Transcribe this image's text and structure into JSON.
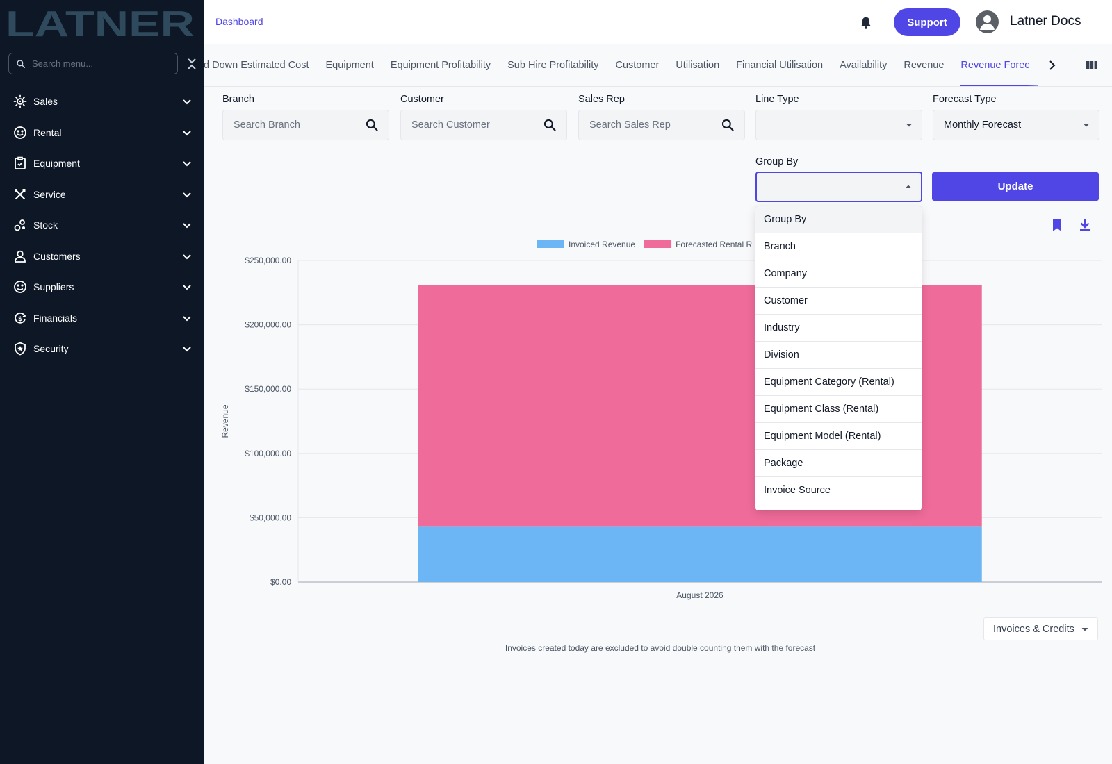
{
  "sidebar": {
    "logo_text": "LATNER",
    "search_placeholder": "Search menu...",
    "items": [
      {
        "label": "Sales",
        "icon": "sales-icon"
      },
      {
        "label": "Rental",
        "icon": "rental-icon"
      },
      {
        "label": "Equipment",
        "icon": "equipment-icon"
      },
      {
        "label": "Service",
        "icon": "service-icon"
      },
      {
        "label": "Stock",
        "icon": "stock-icon"
      },
      {
        "label": "Customers",
        "icon": "customers-icon"
      },
      {
        "label": "Suppliers",
        "icon": "suppliers-icon"
      },
      {
        "label": "Financials",
        "icon": "financials-icon"
      },
      {
        "label": "Security",
        "icon": "security-icon"
      }
    ]
  },
  "header": {
    "breadcrumb": "Dashboard",
    "support_label": "Support",
    "user_name": "Latner Docs"
  },
  "tabs": [
    {
      "label": "Breakdown Estimated Cost",
      "visible_label": "d Down Estimated Cost"
    },
    {
      "label": "Equipment"
    },
    {
      "label": "Equipment Profitability"
    },
    {
      "label": "Sub Hire Profitability"
    },
    {
      "label": "Customer"
    },
    {
      "label": "Utilisation"
    },
    {
      "label": "Financial Utilisation"
    },
    {
      "label": "Availability"
    },
    {
      "label": "Revenue"
    },
    {
      "label": "Revenue Forecast",
      "visible_label": "Revenue Forec"
    }
  ],
  "filters": {
    "branch": {
      "label": "Branch",
      "placeholder": "Search Branch"
    },
    "customer": {
      "label": "Customer",
      "placeholder": "Search Customer"
    },
    "sales_rep": {
      "label": "Sales Rep",
      "placeholder": "Search Sales Rep"
    },
    "line_type": {
      "label": "Line Type",
      "value": ""
    },
    "forecast_type": {
      "label": "Forecast Type",
      "value": "Monthly Forecast"
    },
    "group_by": {
      "label": "Group By",
      "value": ""
    },
    "update_label": "Update"
  },
  "group_by_options": [
    "Group By",
    "Branch",
    "Company",
    "Customer",
    "Industry",
    "Division",
    "Equipment Category (Rental)",
    "Equipment Class (Rental)",
    "Equipment Model (Rental)",
    "Package",
    "Invoice Source"
  ],
  "chart_data": {
    "type": "bar",
    "stacked": true,
    "categories": [
      "August 2026"
    ],
    "series": [
      {
        "name": "Invoiced Revenue",
        "values": [
          43000
        ],
        "color": "#6cb6f5"
      },
      {
        "name": "Forecasted Rental Revenue",
        "visible_name": "Forecasted Rental R",
        "values": [
          188000
        ],
        "color": "#ef6b99"
      }
    ],
    "ylabel": "Revenue",
    "xlabel": "",
    "ylim": [
      0,
      250000
    ],
    "yticks": [
      0,
      50000,
      100000,
      150000,
      200000,
      250000
    ],
    "ytick_labels": [
      "$0.00",
      "$50,000.00",
      "$100,000.00",
      "$150,000.00",
      "$200,000.00",
      "$250,000.00"
    ],
    "grid": true,
    "legend": "top"
  },
  "invoices_selector": "Invoices & Credits",
  "footnote": "Invoices created today are excluded to avoid double counting them with the forecast",
  "colors": {
    "accent": "#4f46e5",
    "sidebar_bg": "#0e1726",
    "logo": "#2e4a5c"
  }
}
